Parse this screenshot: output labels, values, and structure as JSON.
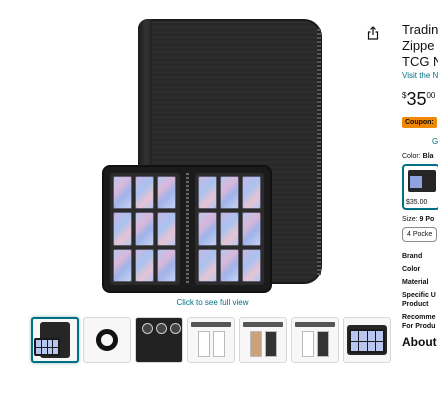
{
  "product": {
    "title_lines": [
      "Tradin",
      "Zippe",
      "TCG N"
    ],
    "store_link": "Visit the N",
    "price": {
      "symbol": "$",
      "whole": "35",
      "fraction": "00"
    },
    "coupon": "Coupon:",
    "coupon_sub": "G",
    "color": {
      "label": "Color:",
      "value": "Bla"
    },
    "swatch_price": "$35.00",
    "size": {
      "label": "Size:",
      "value": "9 Po"
    },
    "size_option": "4 Pocke",
    "specs": [
      "Brand",
      "Color",
      "Material",
      "Specific U Product",
      "Recomme For Produ"
    ],
    "about": "About"
  },
  "gallery": {
    "click_text": "Click to see full view",
    "thumbnails": [
      {
        "name": "binder-open",
        "selected": true
      },
      {
        "name": "binder-details",
        "selected": false
      },
      {
        "name": "binder-features",
        "selected": false
      },
      {
        "name": "page-layout",
        "selected": false
      },
      {
        "name": "color-options",
        "selected": false
      },
      {
        "name": "capacity-chart",
        "selected": false
      },
      {
        "name": "binder-cards",
        "selected": false
      }
    ]
  },
  "icons": {
    "share": "share-icon"
  },
  "colors": {
    "link": "#007185",
    "coupon": "#f08804",
    "binder": "#262626"
  }
}
